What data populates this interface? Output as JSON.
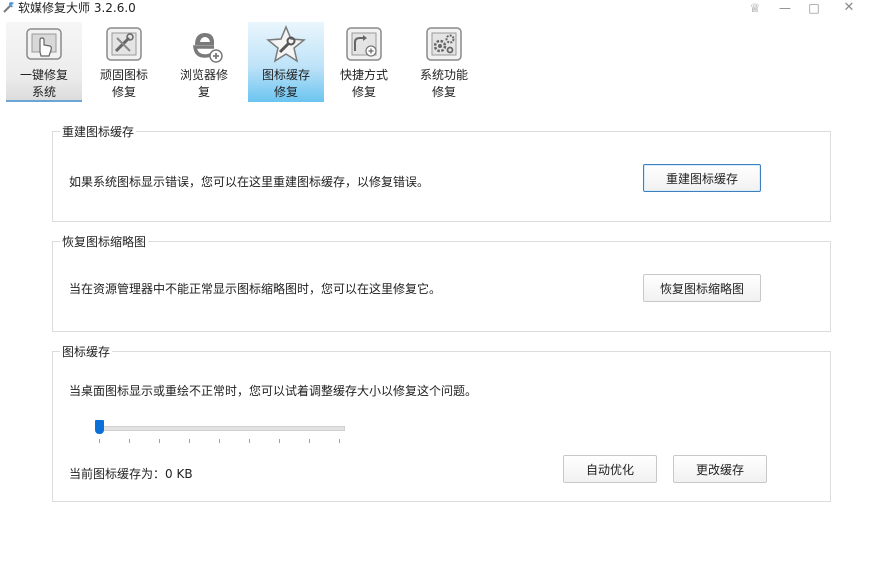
{
  "app": {
    "title": "软媒修复大师 3.2.6.0"
  },
  "window_controls": {
    "skin": "♕",
    "minimize": "—",
    "maximize": "□",
    "close": "✕"
  },
  "toolbar": {
    "tools": [
      {
        "id": "one-click",
        "line1": "一键修复",
        "line2": "系统",
        "icon": "monitor-icon"
      },
      {
        "id": "stubborn-icons",
        "line1": "顽固图标",
        "line2": "修复",
        "icon": "tools-icon"
      },
      {
        "id": "browser",
        "line1": "浏览器修",
        "line2": "复",
        "icon": "browser-icon"
      },
      {
        "id": "icon-cache",
        "line1": "图标缓存",
        "line2": "修复",
        "icon": "star-wrench-icon",
        "active": true
      },
      {
        "id": "shortcut",
        "line1": "快捷方式",
        "line2": "修复",
        "icon": "shortcut-icon"
      },
      {
        "id": "system",
        "line1": "系统功能",
        "line2": "修复",
        "icon": "gears-icon"
      }
    ]
  },
  "rebuild": {
    "title": "重建图标缓存",
    "description": "如果系统图标显示错误，您可以在这里重建图标缓存，以修复错误。",
    "button": "重建图标缓存"
  },
  "thumbnail": {
    "title": "恢复图标缩略图",
    "description": "当在资源管理器中不能正常显示图标缩略图时，您可以在这里修复它。",
    "button": "恢复图标缩略图"
  },
  "cache": {
    "title": "图标缓存",
    "description": "当桌面图标显示或重绘不正常时，您可以试着调整缓存大小以修复这个问题。",
    "slider_value": 0,
    "size_label": "当前图标缓存为：0 KB",
    "auto_button": "自动优化",
    "change_button": "更改缓存"
  },
  "colors": {
    "accent": "#0a6fd6",
    "active_tab": "#6bc4f0",
    "border": "#dcdcdc"
  }
}
